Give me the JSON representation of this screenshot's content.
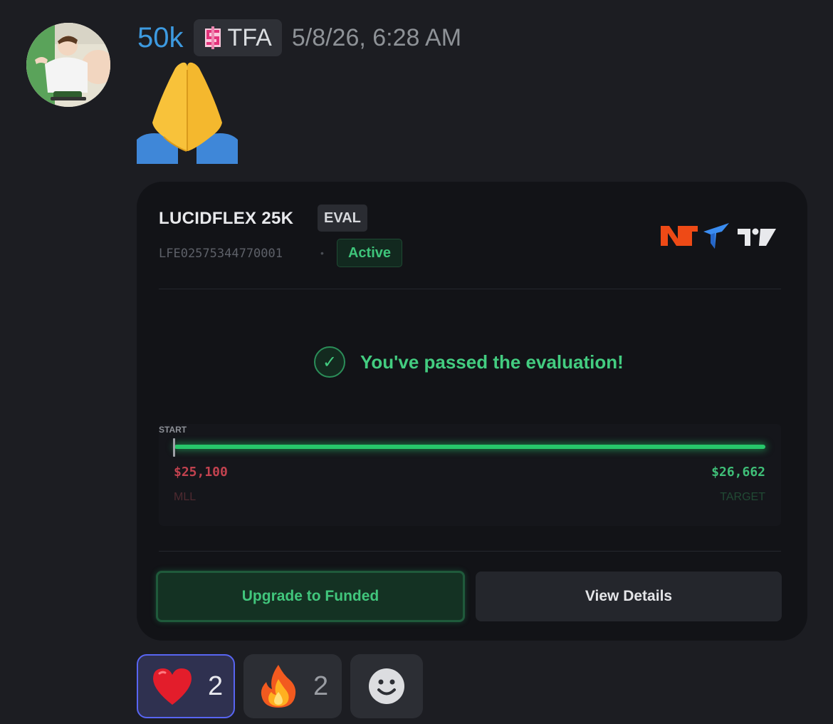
{
  "message": {
    "username": "50k",
    "tag": {
      "text": "TFA",
      "icon": "pink-dollar-pixel-icon"
    },
    "timestamp": "5/8/26, 6:28 AM",
    "avatar": "family-guy-avatar",
    "emoji": "folded-hands-emoji"
  },
  "card": {
    "title": "LUCIDFLEX 25K",
    "type_badge": "EVAL",
    "account_id": "LFE02575344770001",
    "separator": "•",
    "status": "Active",
    "platform_logos": [
      "ninjatrader-logo",
      "tradovate-logo",
      "tradingview-logo"
    ],
    "passed_message": "You've passed the evaluation!",
    "progress": {
      "start_label": "START",
      "mll_value": "$25,100",
      "mll_label": "MLL",
      "target_value": "$26,662",
      "target_label": "TARGET"
    },
    "buttons": {
      "upgrade": "Upgrade to Funded",
      "details": "View Details"
    }
  },
  "reactions": [
    {
      "emoji": "red-heart-emoji",
      "count": "2",
      "selected": true
    },
    {
      "emoji": "fire-emoji",
      "count": "2",
      "selected": false
    }
  ],
  "colors": {
    "background": "#1c1d22",
    "username": "#3d9ae0",
    "success": "#43cc80",
    "danger": "#c2424f",
    "selected_reaction_border": "#5865f2"
  }
}
